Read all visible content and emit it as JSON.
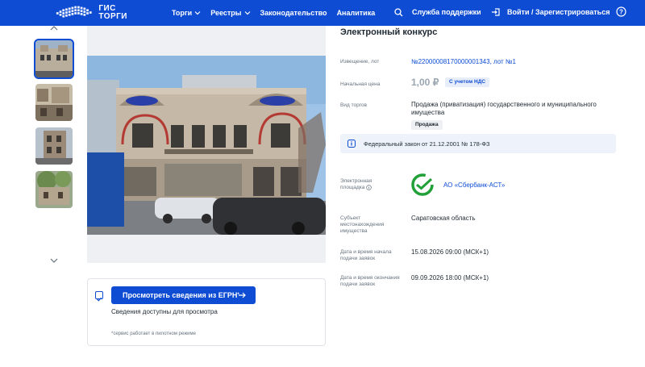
{
  "header": {
    "logo_line1": "ГИС",
    "logo_line2": "ТОРГИ",
    "nav": [
      {
        "label": "Торги",
        "has_menu": true
      },
      {
        "label": "Реестры",
        "has_menu": true
      },
      {
        "label": "Законодательство",
        "has_menu": false
      },
      {
        "label": "Аналитика",
        "has_menu": false
      }
    ],
    "support": "Служба поддержки",
    "login": "Войти / Зарегистрироваться"
  },
  "egrn": {
    "button": "Просмотреть сведения из ЕГРН",
    "button_sup": "*",
    "subtitle": "Сведения доступны для просмотра",
    "note": "*сервис работает в пилотном режиме"
  },
  "details": {
    "title": "Электронный конкурс",
    "notice_label": "Извещение, лот",
    "notice_value": "№22000008170000001343, лот №1",
    "price_label": "Начальная цена",
    "price_value": "1,00 ₽",
    "vat_badge": "С учетом НДС",
    "type_label": "Вид торгов",
    "type_value": "Продажа (приватизация) государственного и муниципального имущества",
    "type_badge": "Продажа",
    "law": "Федеральный закон от 21.12.2001 № 178-ФЗ",
    "platform_label": "Электронная площадка",
    "platform_value": "АО «Сбербанк-АСТ»",
    "region_label": "Субъект местонахождения имущества",
    "region_value": "Саратовская область",
    "start_label": "Дата и время начала подачи заявок",
    "start_value": "15.08.2026 09:00 (МСК+1)",
    "end_label": "Дата и время окончания подачи заявок",
    "end_value": "09.09.2026 18:00 (МСК+1)"
  },
  "colors": {
    "primary": "#0d4cd3",
    "sber_green": "#21a038"
  }
}
